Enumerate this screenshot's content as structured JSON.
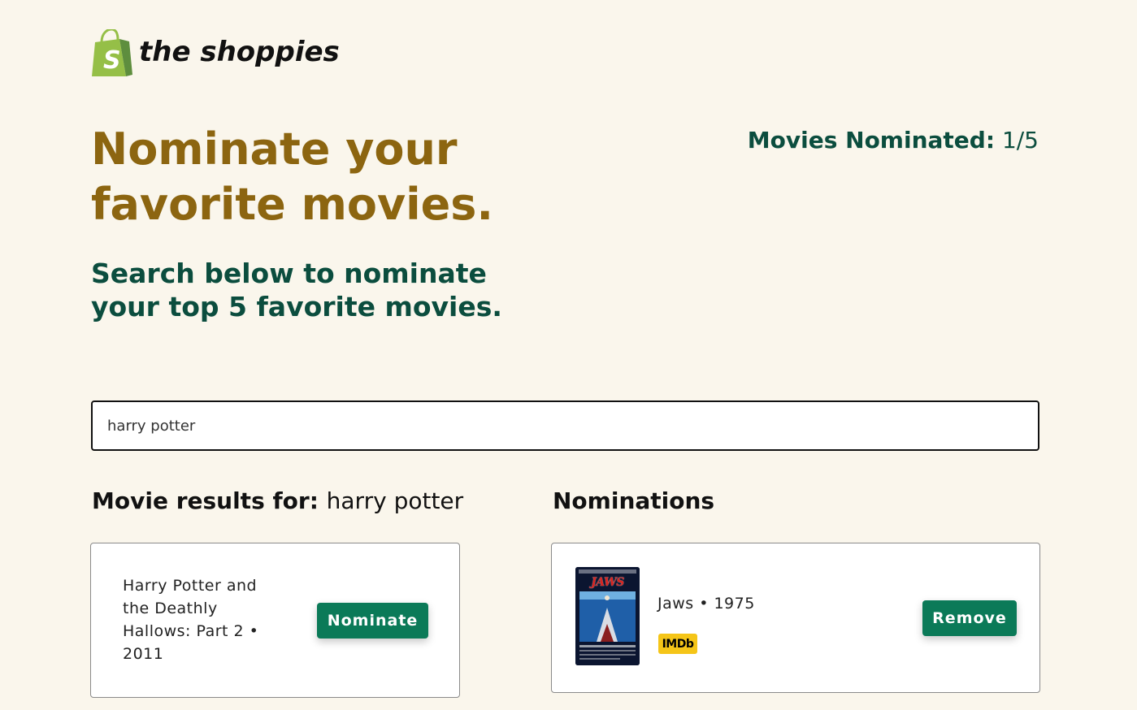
{
  "brand": {
    "name": "the shoppies",
    "icon": "shopify-bag-icon",
    "bag_letter": "S",
    "colors": {
      "bag_light": "#95bf47",
      "bag_dark": "#5e8e3e"
    }
  },
  "hero": {
    "title": "Nominate your favorite movies.",
    "subtitle": "Search below to nominate your top 5 favorite movies."
  },
  "counter": {
    "label": "Movies Nominated:",
    "value": "1/5"
  },
  "search": {
    "value": "harry potter",
    "placeholder": ""
  },
  "results": {
    "heading_label": "Movie results for:",
    "heading_query": "harry potter",
    "items": [
      {
        "title": "Harry Potter and the Deathly Hallows: Part 2 • 2011",
        "button_label": "Nominate"
      }
    ]
  },
  "nominations": {
    "heading": "Nominations",
    "items": [
      {
        "title": "Jaws • 1975",
        "poster_text": "JAWS",
        "imdb_label": "IMDb",
        "button_label": "Remove"
      }
    ]
  },
  "colors": {
    "background": "#faf6ec",
    "hero_title": "#8c6510",
    "accent_green": "#0b4d3e",
    "button_green": "#0b7a58",
    "imdb_yellow": "#f5c518"
  }
}
